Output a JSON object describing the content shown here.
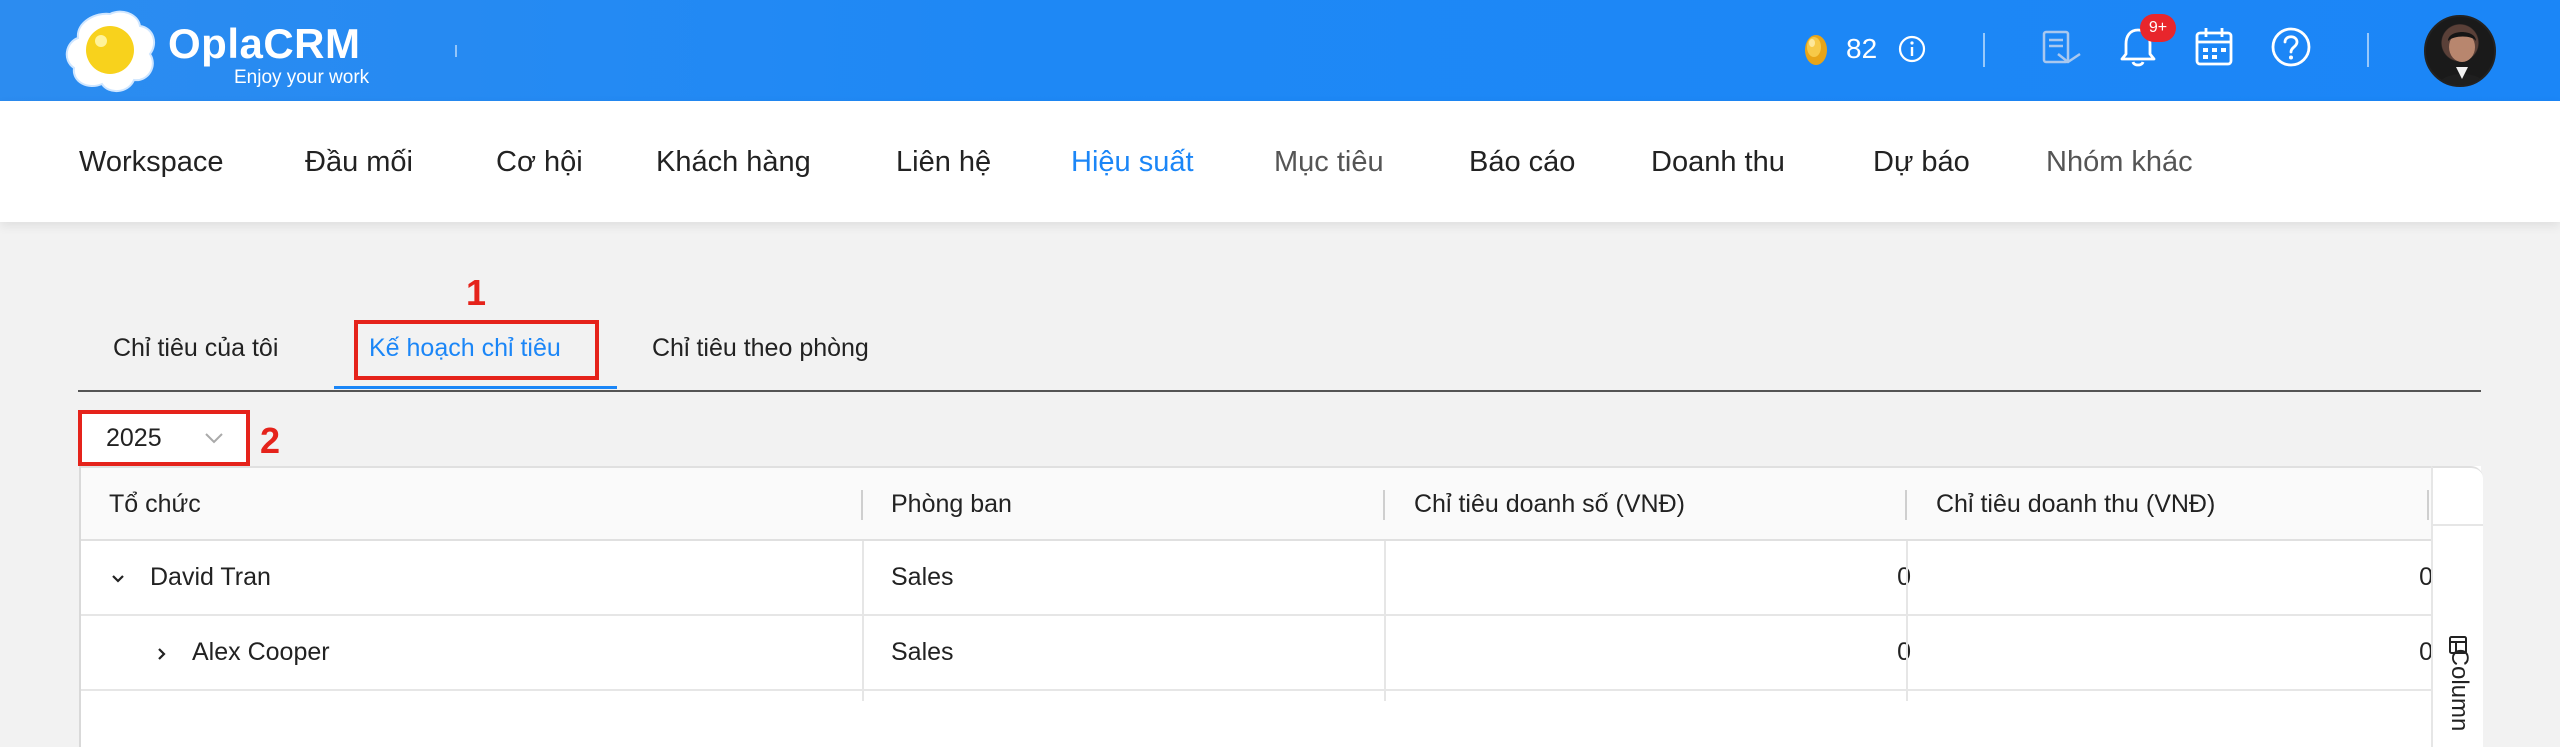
{
  "header": {
    "brand": "OplaCRM",
    "tagline": "Enjoy your work",
    "coin_count": "82",
    "notification_badge": "9+",
    "accent_color": "#1b86f7",
    "icons": [
      "coin-icon",
      "info-icon",
      "tasks-icon",
      "bell-icon",
      "calendar-icon",
      "help-icon",
      "avatar"
    ]
  },
  "nav": {
    "items": [
      {
        "label": "Workspace"
      },
      {
        "label": "Đầu mối"
      },
      {
        "label": "Cơ hội"
      },
      {
        "label": "Khách hàng"
      },
      {
        "label": "Liên hệ"
      },
      {
        "label": "Hiệu suất",
        "active": true
      },
      {
        "label": "Mục tiêu"
      },
      {
        "label": "Báo cáo"
      },
      {
        "label": "Doanh thu"
      },
      {
        "label": "Dự báo"
      },
      {
        "label": "Nhóm khác"
      }
    ]
  },
  "tabs": [
    {
      "label": "Chỉ tiêu của tôi"
    },
    {
      "label": "Kế hoạch chỉ tiêu",
      "active": true
    },
    {
      "label": "Chỉ tiêu theo phòng"
    }
  ],
  "annotations": {
    "marker1": "1",
    "marker2": "2",
    "color": "#e5231b"
  },
  "year_select": {
    "value": "2025"
  },
  "table": {
    "columns": [
      "Tổ chức",
      "Phòng ban",
      "Chỉ tiêu doanh số (VNĐ)",
      "Chỉ tiêu doanh thu (VNĐ)"
    ],
    "rows": [
      {
        "org": "David Tran",
        "department": "Sales",
        "sales_target": "0",
        "revenue_target": "0",
        "expanded": true
      },
      {
        "org": "Alex Cooper",
        "department": "Sales",
        "sales_target": "0",
        "revenue_target": "0",
        "expanded": false
      }
    ],
    "column_panel_label": "Column"
  }
}
